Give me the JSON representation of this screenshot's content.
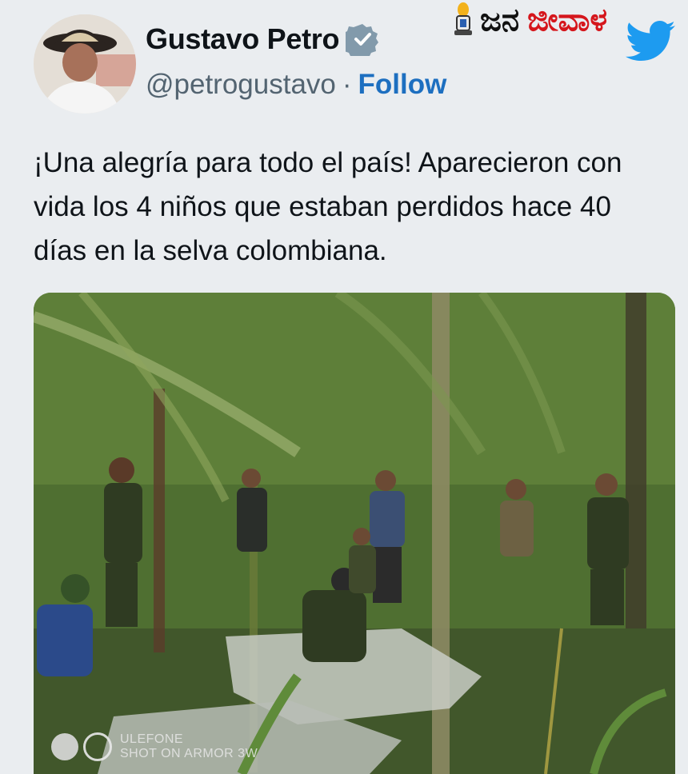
{
  "author": {
    "name": "Gustavo Petro",
    "handle": "@petrogustavo",
    "separator": "·",
    "follow_label": "Follow",
    "verified_icon": "verified-badge-icon"
  },
  "brand": {
    "text_a": "ಜನ",
    "text_b": "ಜೀವಾಳ",
    "logo_icon": "lamp-logo-icon",
    "platform_icon": "twitter-bird-icon"
  },
  "tweet": {
    "text": "¡Una alegría para todo el país! Aparecieron con vida los 4 niños que estaban perdidos hace 40 días en la selva colombiana."
  },
  "photo": {
    "watermark_line1": "ULEFONE",
    "watermark_line2": "SHOT ON ARMOR 3W"
  },
  "colors": {
    "follow": "#1d6fc0",
    "verified": "#829aab",
    "brand_red": "#d5161c",
    "twitter_blue": "#1d9bf0"
  }
}
